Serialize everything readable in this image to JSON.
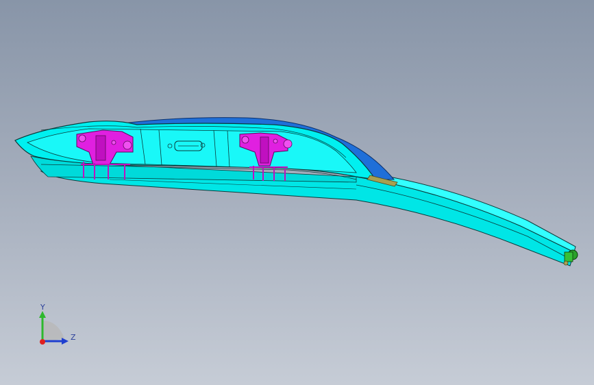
{
  "viewport": {
    "background_top": "#8895a8",
    "background_bottom": "#c6ccd6"
  },
  "model": {
    "body_color": "#00f0f0",
    "edge_color": "#0a3a3a",
    "cover_color": "#1f6fd8",
    "bracket_color": "#e020e0",
    "connector_color": "#2aa02a",
    "handle_color": "#a8a050"
  },
  "triad": {
    "y_label": "Y",
    "z_label": "Z",
    "y_color": "#2db82d",
    "z_color": "#1f3fd0",
    "origin_color": "#e02020"
  }
}
